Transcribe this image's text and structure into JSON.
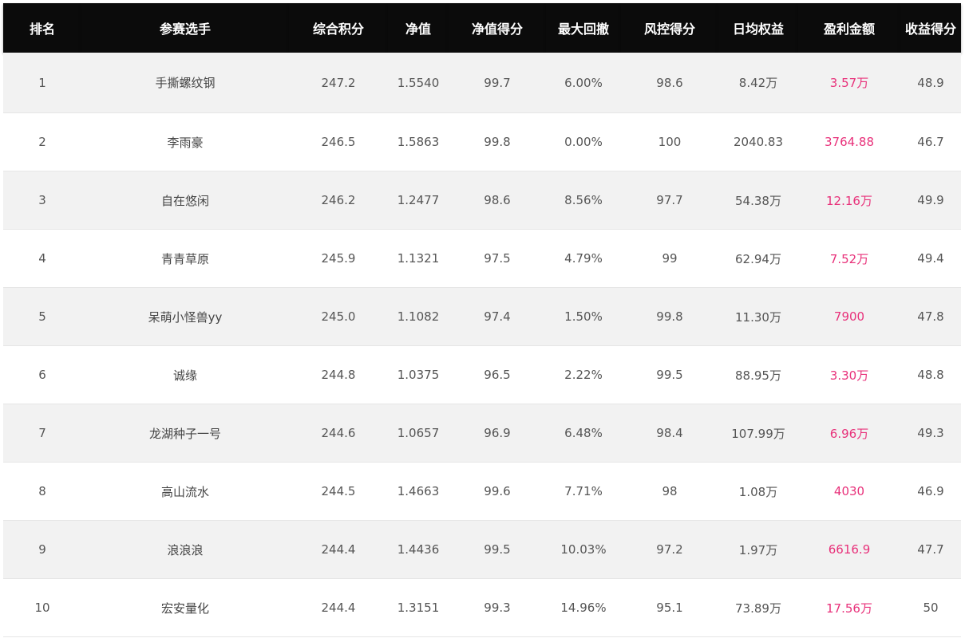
{
  "headers": [
    "排名",
    "参赛选手",
    "综合积分",
    "净值",
    "净值得分",
    "最大回撤",
    "风控得分",
    "日均权益",
    "盈利金额",
    "收益得分"
  ],
  "rows": [
    [
      "1",
      "手撕螺纹钢",
      "247.2",
      "1.5540",
      "99.7",
      "6.00%",
      "98.6",
      "8.42万",
      "3.57万",
      "48.9"
    ],
    [
      "2",
      "李雨豪",
      "246.5",
      "1.5863",
      "99.8",
      "0.00%",
      "100",
      "2040.83",
      "3764.88",
      "46.7"
    ],
    [
      "3",
      "自在悠闲",
      "246.2",
      "1.2477",
      "98.6",
      "8.56%",
      "97.7",
      "54.38万",
      "12.16万",
      "49.9"
    ],
    [
      "4",
      "青青草原",
      "245.9",
      "1.1321",
      "97.5",
      "4.79%",
      "99",
      "62.94万",
      "7.52万",
      "49.4"
    ],
    [
      "5",
      "呆萌小怪兽yy",
      "245.0",
      "1.1082",
      "97.4",
      "1.50%",
      "99.8",
      "11.30万",
      "7900",
      "47.8"
    ],
    [
      "6",
      "诚缘",
      "244.8",
      "1.0375",
      "96.5",
      "2.22%",
      "99.5",
      "88.95万",
      "3.30万",
      "48.8"
    ],
    [
      "7",
      "龙湖种子一号",
      "244.6",
      "1.0657",
      "96.9",
      "6.48%",
      "98.4",
      "107.99万",
      "6.96万",
      "49.3"
    ],
    [
      "8",
      "高山流水",
      "244.5",
      "1.4663",
      "99.6",
      "7.71%",
      "98",
      "1.08万",
      "4030",
      "46.9"
    ],
    [
      "9",
      "浪浪浪",
      "244.4",
      "1.4436",
      "99.5",
      "10.03%",
      "97.2",
      "1.97万",
      "6616.9",
      "47.7"
    ],
    [
      "10",
      "宏安量化",
      "244.4",
      "1.3151",
      "99.3",
      "14.96%",
      "95.1",
      "73.89万",
      "17.56万",
      "50"
    ]
  ],
  "colors": {
    "header_bg": "#0b0b0b",
    "header_text": "#ffffff",
    "profit": "#e8317a",
    "row_alt": "#f2f2f2"
  }
}
